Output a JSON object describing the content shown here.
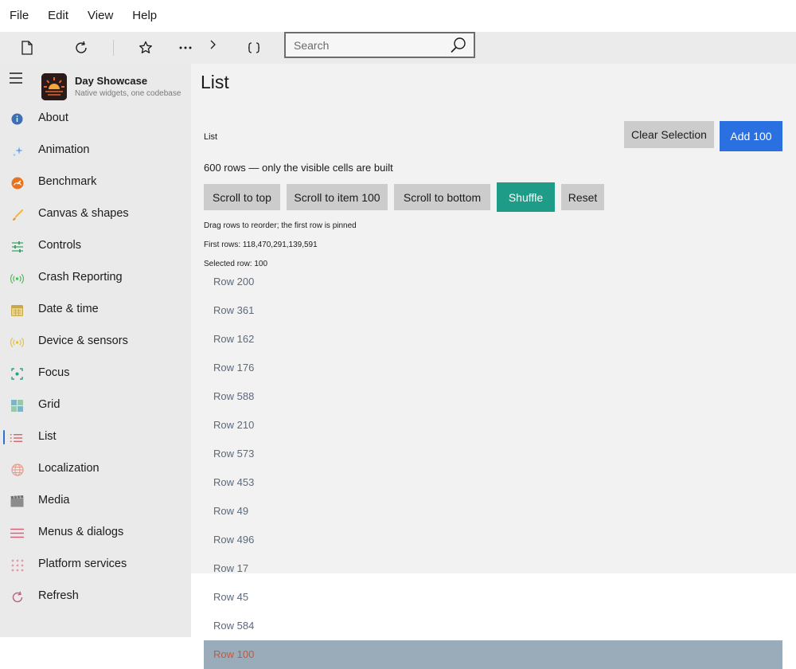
{
  "menu": [
    "File",
    "Edit",
    "View",
    "Help"
  ],
  "toolbar": {
    "search_placeholder": "Search",
    "icons": [
      "document-icon",
      "refresh-icon",
      "star-icon",
      "more-icon",
      "chevron-right-icon",
      "braces-icon",
      "search-icon"
    ]
  },
  "brand": {
    "title": "Day Showcase",
    "subtitle": "Native widgets, one codebase"
  },
  "sidebar": {
    "items": [
      {
        "label": "About",
        "icon": "info-icon",
        "color": "#3b6fb6"
      },
      {
        "label": "Animation",
        "icon": "sparkle-icon",
        "color": "#6aa6e8"
      },
      {
        "label": "Benchmark",
        "icon": "gauge-icon",
        "color": "#e8731e"
      },
      {
        "label": "Canvas & shapes",
        "icon": "brush-icon",
        "color": "#f0b84a"
      },
      {
        "label": "Controls",
        "icon": "sliders-icon",
        "color": "#3aa36a"
      },
      {
        "label": "Crash Reporting",
        "icon": "broadcast-icon",
        "color": "#4cbf5a"
      },
      {
        "label": "Date & time",
        "icon": "calendar-icon",
        "color": "#c9a84a"
      },
      {
        "label": "Device & sensors",
        "icon": "signal-icon",
        "color": "#e6c23a"
      },
      {
        "label": "Focus",
        "icon": "focus-icon",
        "color": "#2e9d8a"
      },
      {
        "label": "Grid",
        "icon": "grid-icon",
        "color": "#7fb4c6"
      },
      {
        "label": "List",
        "icon": "list-icon",
        "color": "#d65252"
      },
      {
        "label": "Localization",
        "icon": "globe-icon",
        "color": "#e59a8a"
      },
      {
        "label": "Media",
        "icon": "clapper-icon",
        "color": "#8c8c8c"
      },
      {
        "label": "Menus & dialogs",
        "icon": "menu-lines-icon",
        "color": "#d9627a"
      },
      {
        "label": "Platform services",
        "icon": "dots-grid-icon",
        "color": "#e39aa6"
      },
      {
        "label": "Refresh",
        "icon": "refresh-circle-icon",
        "color": "#b5637a"
      }
    ],
    "active": "List"
  },
  "main": {
    "title": "List",
    "list_label": "List",
    "clear_selection": "Clear Selection",
    "add_100": "Add 100",
    "rows_text": "600 rows — only the visible cells are built",
    "buttons": {
      "scroll_top": "Scroll to top",
      "scroll_item": "Scroll to item 100",
      "scroll_bottom": "Scroll to bottom",
      "shuffle": "Shuffle",
      "reset": "Reset"
    },
    "drag_hint": "Drag rows to reorder; the first row is pinned",
    "first_rows": "First rows: 118,470,291,139,591",
    "selected_row": "Selected row: 100"
  },
  "rows": [
    "Row 200",
    "Row 361",
    "Row 162",
    "Row 176",
    "Row 588",
    "Row 210",
    "Row 573",
    "Row 453",
    "Row 49",
    "Row 496",
    "Row 17",
    "Row 45",
    "Row 584",
    "Row 100"
  ],
  "selected_index": 13,
  "colors": {
    "accent_blue": "#2a70e0",
    "shuffle_teal": "#1f9c87",
    "selected_row_bg": "#9aabba",
    "selected_row_text": "#c55a3a"
  }
}
